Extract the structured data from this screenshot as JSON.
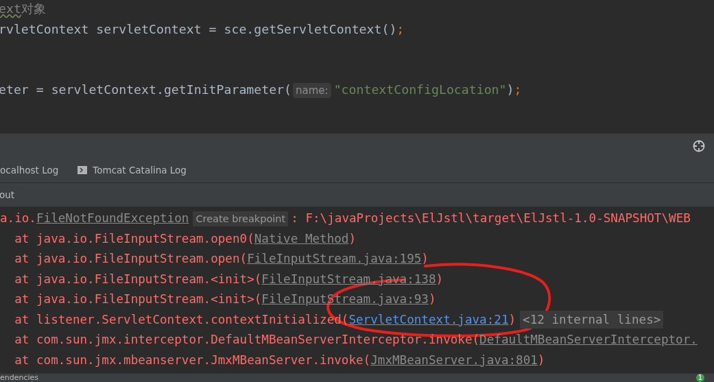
{
  "editor": {
    "lines": [
      {
        "segments": [
          {
            "kind": "comment_typo",
            "text": "ext"
          },
          {
            "kind": "comment",
            "text": "对象"
          }
        ]
      },
      {
        "segments": [
          {
            "kind": "plain",
            "text": "rvletContext servletContext = sce.getServletContext()"
          },
          {
            "kind": "punct",
            "text": ";"
          }
        ]
      },
      {
        "segments": [
          {
            "kind": "plain",
            "text": "eter = servletContext.getInitParameter("
          },
          {
            "kind": "hint",
            "text": "name:"
          },
          {
            "kind": "string",
            "text": "\"contextConfigLocation\""
          },
          {
            "kind": "plain",
            "text": ")"
          },
          {
            "kind": "punct",
            "text": ";"
          }
        ]
      }
    ]
  },
  "panel": {
    "tabs": [
      {
        "label": "ocalhost Log",
        "icon": false,
        "selected": false
      },
      {
        "label": "Tomcat Catalina Log",
        "icon": true,
        "selected": false
      }
    ],
    "subtab": "out"
  },
  "console": {
    "lines": [
      {
        "segments": [
          {
            "kind": "text",
            "text": "a.io."
          },
          {
            "kind": "link",
            "text": "FileNotFoundException"
          },
          {
            "kind": "chip",
            "text": "Create breakpoint"
          },
          {
            "kind": "text",
            "text": ": F:\\javaProjects\\ElJstl\\target\\ElJstl-1.0-SNAPSHOT\\WEB"
          }
        ]
      },
      {
        "segments": [
          {
            "kind": "text",
            "text": "  at java.io.FileInputStream.open0("
          },
          {
            "kind": "link",
            "text": "Native Method"
          },
          {
            "kind": "text",
            "text": ")"
          }
        ]
      },
      {
        "segments": [
          {
            "kind": "text",
            "text": "  at java.io.FileInputStream.open("
          },
          {
            "kind": "link",
            "text": "FileInputStream.java:195"
          },
          {
            "kind": "text",
            "text": ")"
          }
        ]
      },
      {
        "segments": [
          {
            "kind": "text",
            "text": "  at java.io.FileInputStream.<init>("
          },
          {
            "kind": "link",
            "text": "FileInputStream.java:138"
          },
          {
            "kind": "text",
            "text": ")"
          }
        ]
      },
      {
        "segments": [
          {
            "kind": "text",
            "text": "  at java.io.FileInputStream.<init>("
          },
          {
            "kind": "link",
            "text": "FileInputStream.java:93"
          },
          {
            "kind": "text",
            "text": ")"
          }
        ]
      },
      {
        "segments": [
          {
            "kind": "text",
            "text": "  at listener.ServletContext.contextInitialized("
          },
          {
            "kind": "source_link",
            "text": "ServletContext.java:21"
          },
          {
            "kind": "text",
            "text": ")"
          },
          {
            "kind": "chip",
            "text": "<12 internal lines>"
          }
        ]
      },
      {
        "segments": [
          {
            "kind": "text",
            "text": "  at com.sun.jmx.interceptor.DefaultMBeanServerInterceptor.invoke("
          },
          {
            "kind": "link",
            "text": "DefaultMBeanServerInterceptor."
          }
        ]
      },
      {
        "segments": [
          {
            "kind": "text",
            "text": "  at com.sun.jmx.mbeanserver.JmxMBeanServer.invoke("
          },
          {
            "kind": "link",
            "text": "JmxMBeanServer.java:801"
          },
          {
            "kind": "text",
            "text": ")"
          }
        ]
      }
    ]
  },
  "status_bar": {
    "text": "endencies",
    "badge": "1"
  }
}
